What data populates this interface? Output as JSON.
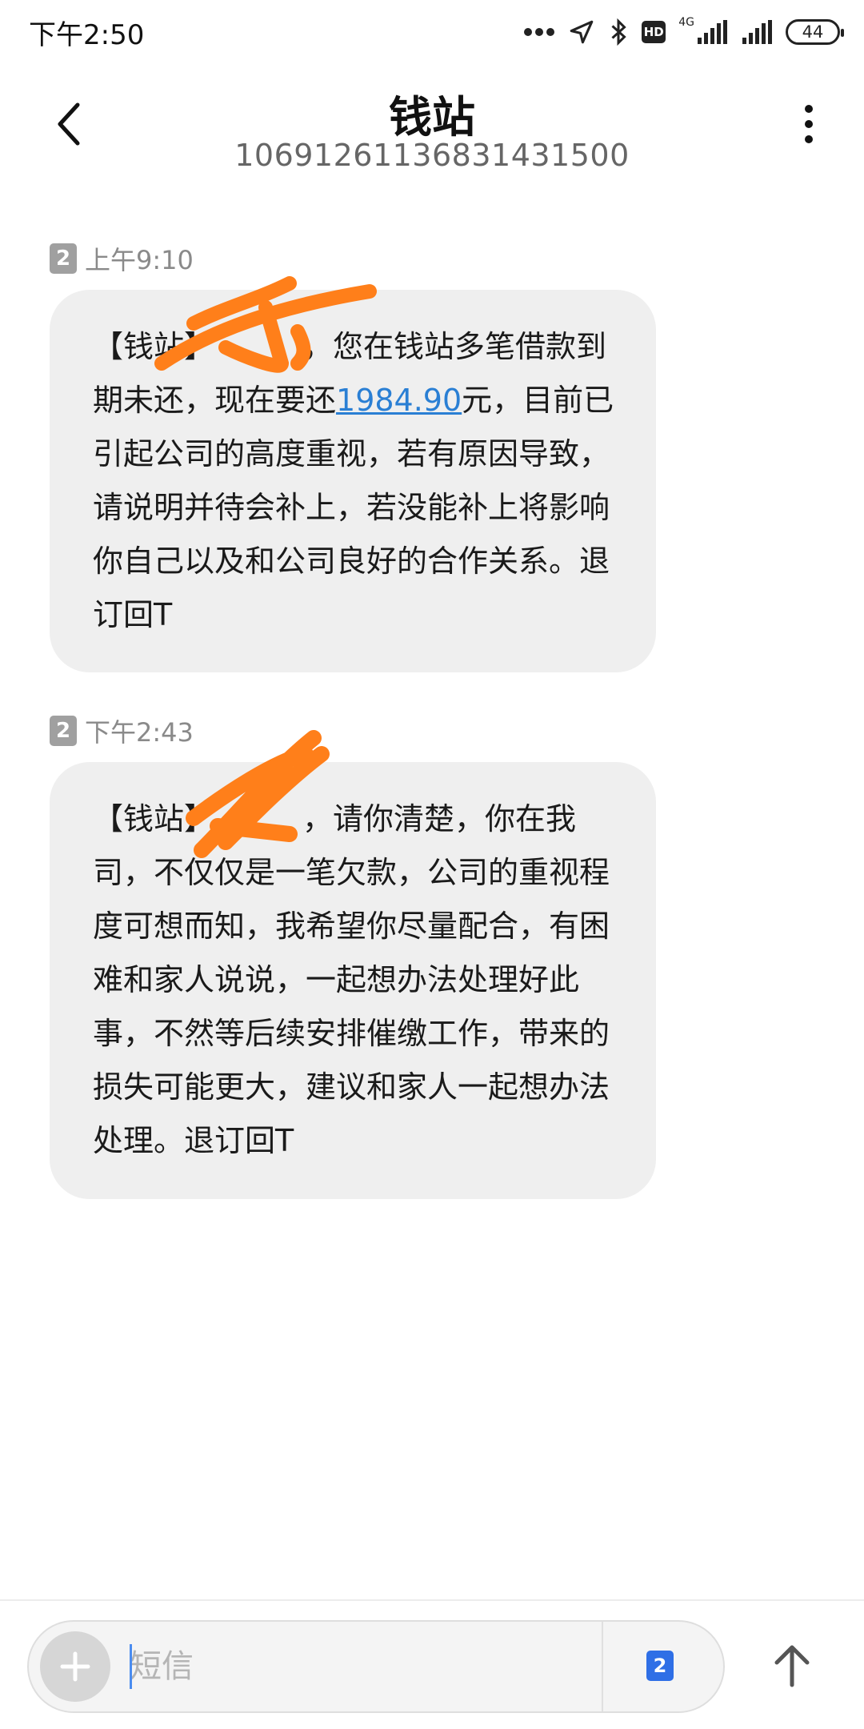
{
  "status_bar": {
    "time": "下午2:50",
    "network": "4G",
    "hd": "HD",
    "battery": "44"
  },
  "header": {
    "contact_name": "钱站",
    "contact_number": "1069126113683143​1500"
  },
  "messages": [
    {
      "sim": "2",
      "time": "上午9:10",
      "text_before": "【钱站】",
      "text_middle": "，您在钱站多笔借款到期未还，现在要还",
      "amount": "1984.90",
      "text_after": "元，目前已引起公司的高度重视，若有原因导致，请说明并待会补上，若没能补上将影响你自己以及和公司良好的合作关系。退订回T"
    },
    {
      "sim": "2",
      "time": "下午2:43",
      "text_before": "【钱站】",
      "text_middle": "，请你清楚，你在我司，不仅仅是一笔欠款，公司的重视程度可想而知，我希望你尽量配合，有困难和家人说说，一起想办法处理好此事，不然等后续安排催缴工作，带来的损失可能更大，建议和家人一起想办法处理。退订回T"
    }
  ],
  "composer": {
    "placeholder": "短信",
    "sim": "2"
  },
  "colors": {
    "bubble": "#efefef",
    "link": "#2a7fd4",
    "sim_badge_active": "#2f6fe6",
    "redaction": "#ff7f1a"
  }
}
